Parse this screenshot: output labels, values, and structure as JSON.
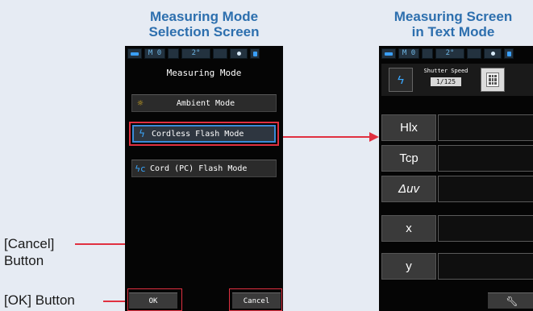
{
  "left_heading": [
    "Measuring Mode",
    "Selection Screen"
  ],
  "right_heading": [
    "Measuring Screen",
    "in Text Mode"
  ],
  "callouts": {
    "cancel": [
      "[Cancel]",
      "Button"
    ],
    "ok": "[OK] Button"
  },
  "status_bar": {
    "mode": "M 0",
    "angle": "2°"
  },
  "mode_screen": {
    "title": "Measuring Mode",
    "options": [
      {
        "label": "Ambient Mode",
        "icon": "sun-icon",
        "selected": false
      },
      {
        "label": "Cordless Flash Mode",
        "icon": "flash-icon",
        "selected": true
      },
      {
        "label": "Cord (PC) Flash Mode",
        "icon": "cord-flash-icon",
        "selected": false
      }
    ],
    "ok_label": "OK",
    "cancel_label": "Cancel"
  },
  "text_screen": {
    "shutter_label": "Shutter Speed",
    "shutter_value": "1/125",
    "rows": [
      "Hlx",
      "Tcp",
      "Δuv",
      "x",
      "y"
    ]
  },
  "colors": {
    "heading": "#2d6fae",
    "highlight": "#e03040",
    "selection": "#3a8bd8"
  }
}
